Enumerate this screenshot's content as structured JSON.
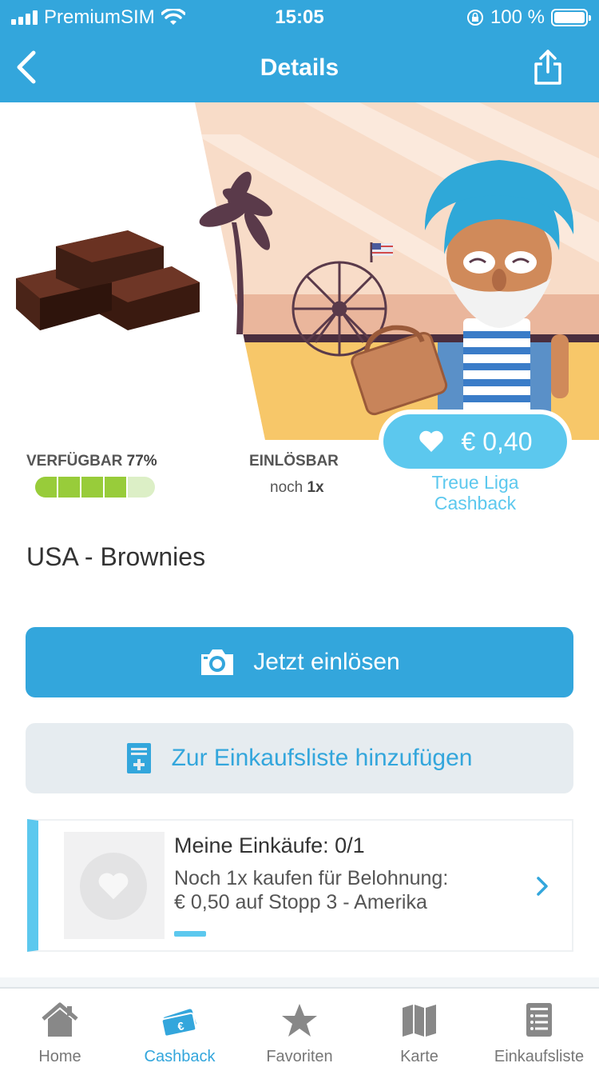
{
  "status_bar": {
    "carrier": "PremiumSIM",
    "time": "15:05",
    "battery": "100 %"
  },
  "nav": {
    "title": "Details",
    "back_icon": "chevron-left-icon",
    "share_icon": "share-icon"
  },
  "stats": {
    "available_label": "VERFÜGBAR",
    "available_value": "77%",
    "available_fraction": 0.77,
    "redeemable_label": "EINLÖSBAR",
    "redeemable_prefix": "noch",
    "redeemable_count": "1x"
  },
  "price": {
    "amount": "€ 0,40",
    "icon": "heart-icon",
    "caption_line1": "Treue Liga",
    "caption_line2": "Cashback"
  },
  "product": {
    "title": "USA - Brownies"
  },
  "actions": {
    "redeem_label": "Jetzt einlösen",
    "add_list_label": "Zur Einkaufsliste hinzufügen"
  },
  "purchases_card": {
    "title": "Meine Einkäufe: 0/1",
    "reward_line": "Noch 1x kaufen für Belohnung:",
    "reward_detail": "€ 0,50 auf Stopp 3 - Amerika",
    "progress": 0
  },
  "tabs": [
    {
      "label": "Home",
      "icon": "home-icon",
      "active": false
    },
    {
      "label": "Cashback",
      "icon": "cashback-icon",
      "active": true
    },
    {
      "label": "Favoriten",
      "icon": "star-icon",
      "active": false
    },
    {
      "label": "Karte",
      "icon": "map-icon",
      "active": false
    },
    {
      "label": "Einkaufsliste",
      "icon": "list-icon",
      "active": false
    }
  ],
  "colors": {
    "primary": "#33a6dc",
    "accent": "#5cc8ee",
    "green": "#98cc3a"
  }
}
